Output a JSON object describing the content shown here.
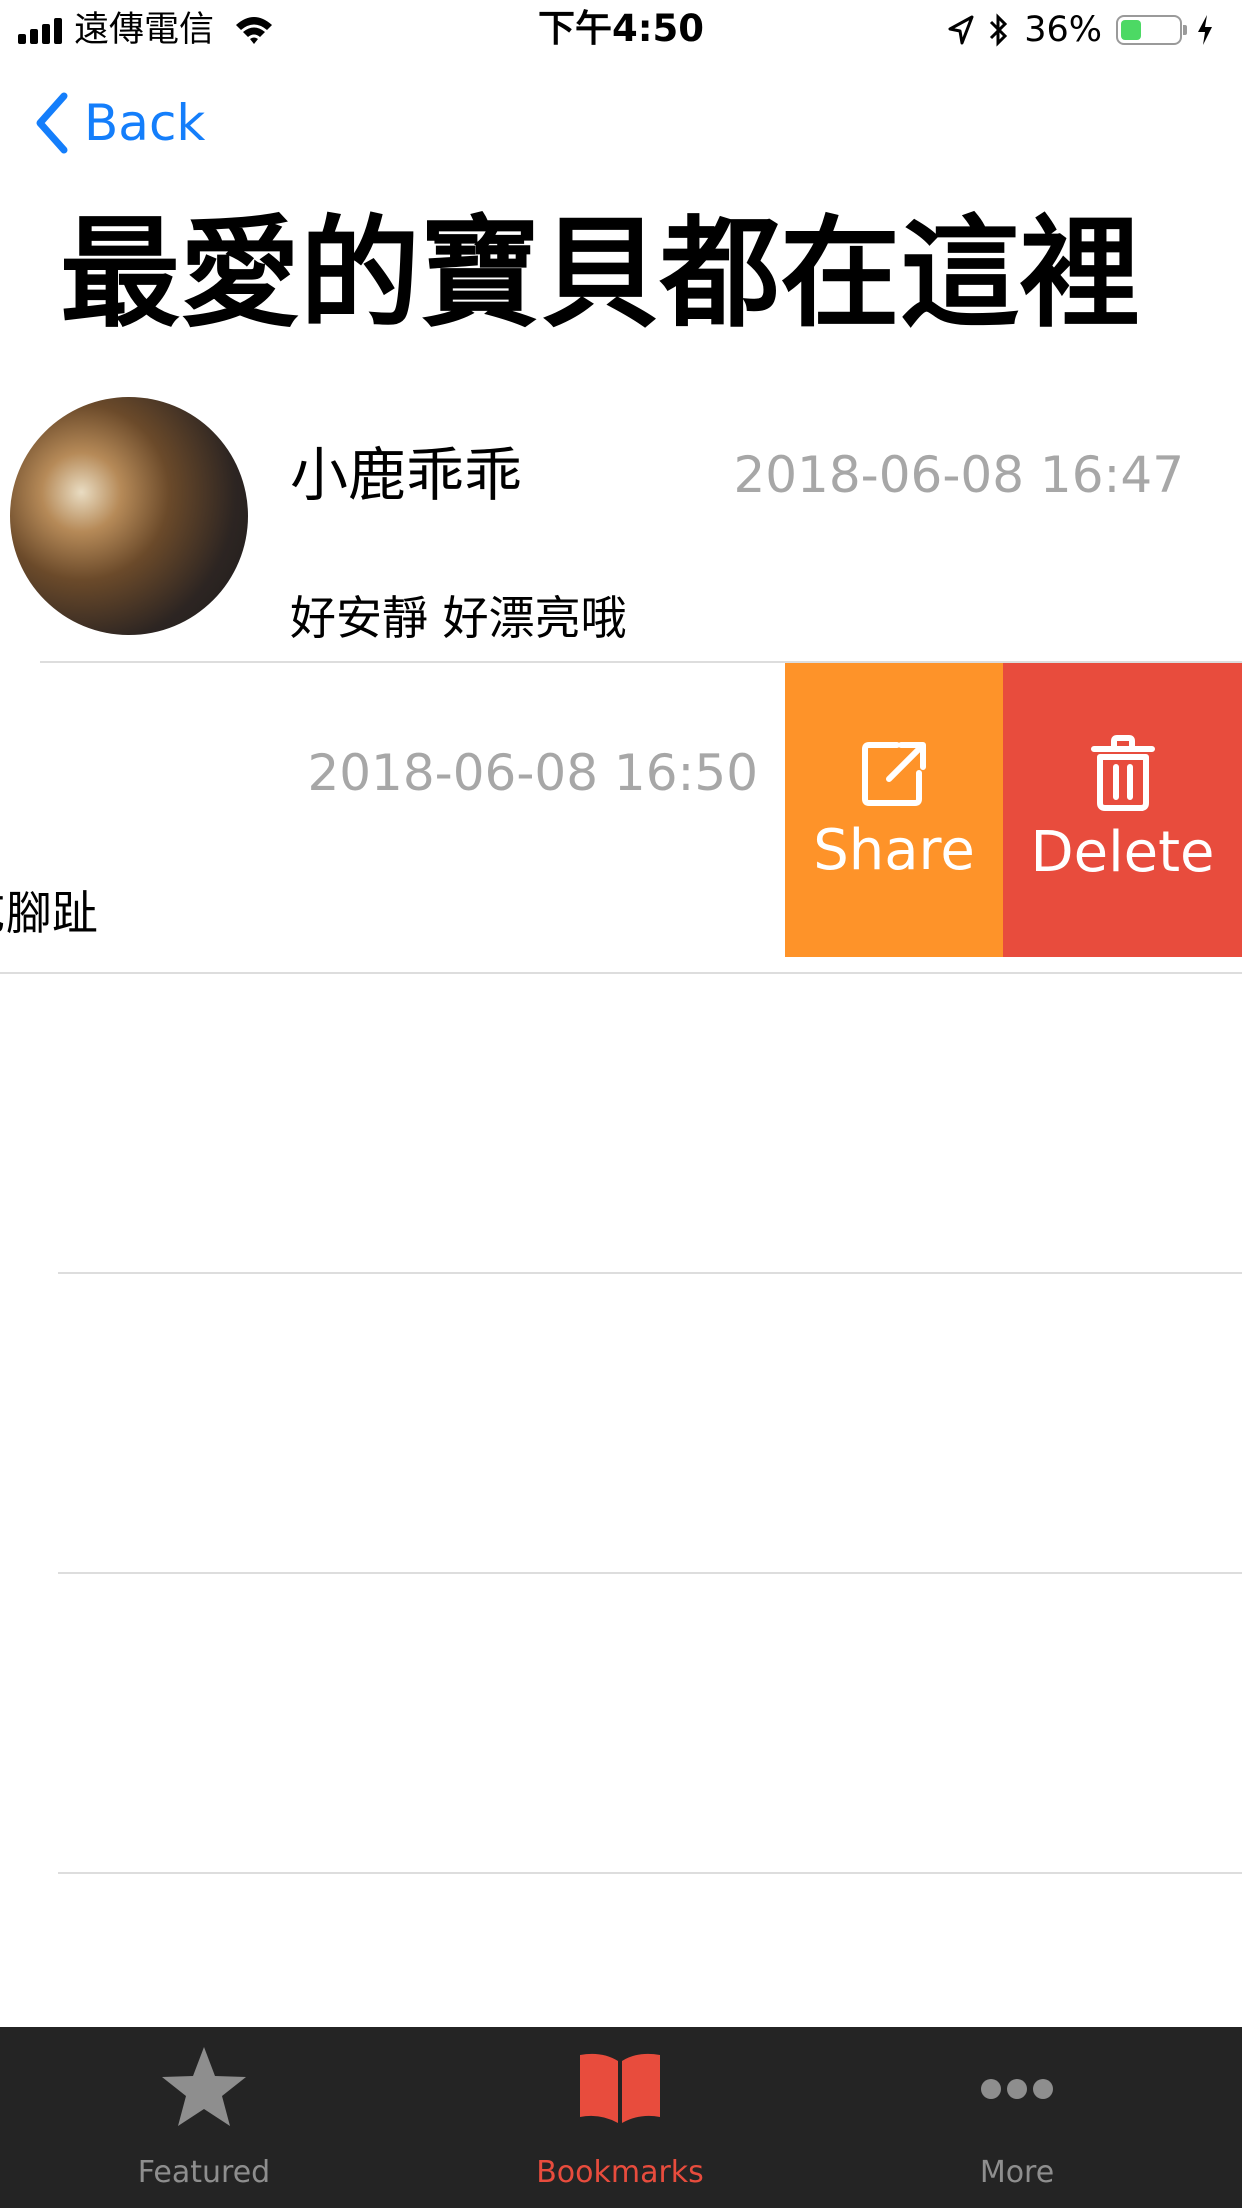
{
  "status_bar": {
    "carrier": "遠傳電信",
    "time": "下午4:50",
    "battery_percent": "36%",
    "battery_level": 0.36,
    "battery_color": "#4cd964"
  },
  "nav": {
    "back_label": "Back",
    "title": "最愛的寶貝都在這裡",
    "accent": "#147efb"
  },
  "list": {
    "items": [
      {
        "name": "小鹿乖乖",
        "date": "2018-06-08 16:47",
        "description": "好安靜 好漂亮哦"
      },
      {
        "date": "2018-06-08 16:50",
        "description_visible": "乞腳趾"
      }
    ],
    "swipe_actions": [
      {
        "label": "Share",
        "icon": "share-icon",
        "color": "#fe9329"
      },
      {
        "label": "Delete",
        "icon": "trash-icon",
        "color": "#e84c3d"
      }
    ]
  },
  "tab_bar": {
    "background": "#242424",
    "tabs": [
      {
        "label": "Featured",
        "icon": "star-icon",
        "color": "#8e8e8e",
        "selected": false
      },
      {
        "label": "Bookmarks",
        "icon": "book-icon",
        "color": "#e84c3d",
        "selected": true
      },
      {
        "label": "More",
        "icon": "more-icon",
        "color": "#8e8e8e",
        "selected": false
      }
    ]
  }
}
